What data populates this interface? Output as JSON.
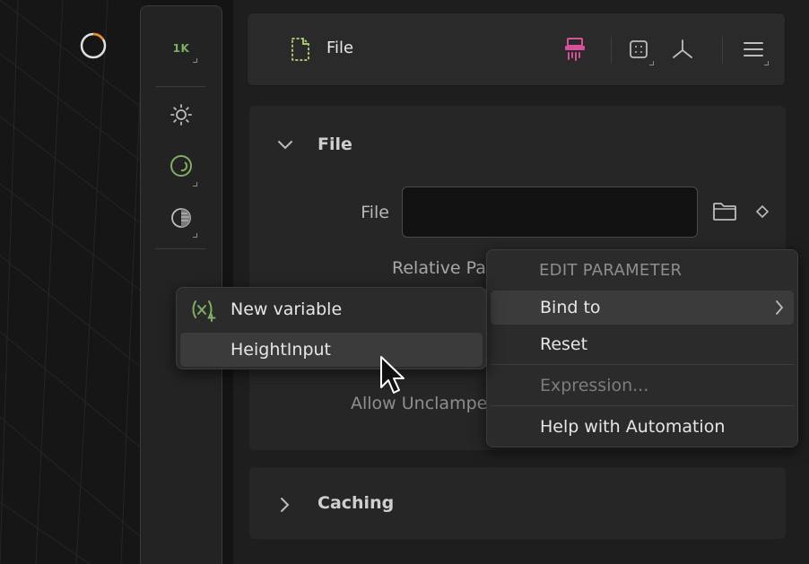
{
  "toolbar": {
    "resolution_label": "1K",
    "items": [
      {
        "icon": "sun-icon"
      },
      {
        "icon": "environment-icon"
      },
      {
        "icon": "render-mode-icon"
      }
    ]
  },
  "header": {
    "title": "File",
    "icons": [
      "file-icon",
      "shredder-icon",
      "frame-icon",
      "graph-icon",
      "hamburger-menu-icon"
    ],
    "accent_color": "#d9509a",
    "file_icon_color": "#a7c46a"
  },
  "sections": [
    {
      "title": "File",
      "expanded": true
    },
    {
      "title": "Caching",
      "expanded": false
    }
  ],
  "fields": {
    "file_label": "File",
    "file_value": "",
    "relative_path_label": "Relative Pat",
    "allow_unclamped_label": "Allow Unclampe"
  },
  "context_menu": {
    "heading": "EDIT PARAMETER",
    "items": [
      {
        "label": "Bind to",
        "highlighted": true,
        "submenu": true
      },
      {
        "label": "Reset"
      },
      {
        "label": "Expression...",
        "disabled": true
      },
      {
        "label": "Help with Automation"
      }
    ]
  },
  "submenu": {
    "items": [
      {
        "label": "New variable",
        "icon": "variable-add-icon"
      },
      {
        "label": "HeightInput",
        "highlighted": true
      }
    ]
  }
}
